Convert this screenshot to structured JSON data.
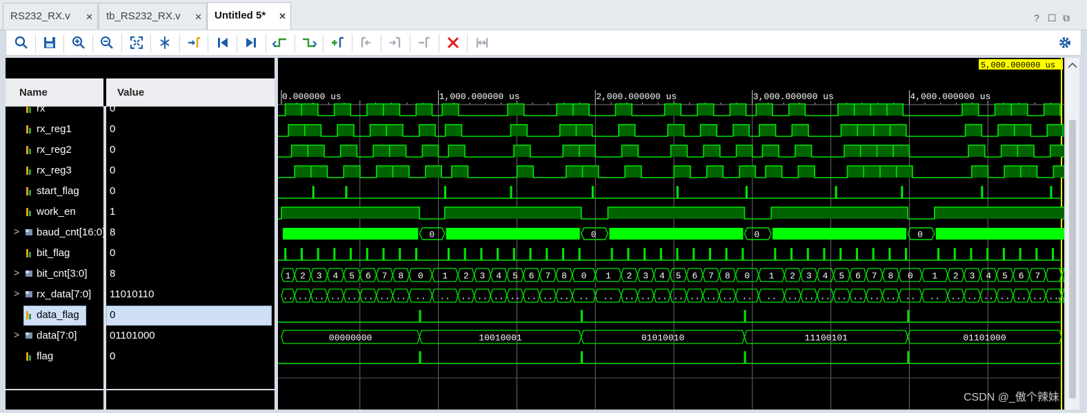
{
  "tabs": [
    {
      "label": "RS232_RX.v",
      "active": false
    },
    {
      "label": "tb_RS232_RX.v",
      "active": false
    },
    {
      "label": "Untitled 5*",
      "active": true
    }
  ],
  "window_controls": [
    "?",
    "☐",
    "⧉"
  ],
  "toolbar_icons": [
    "search-icon",
    "save-icon",
    "zoom-in-icon",
    "zoom-out-icon",
    "zoom-fit-icon",
    "cursor-icon",
    "go-to-time-0-icon",
    "go-to-start-icon",
    "go-to-end-icon",
    "previous-transition-icon",
    "next-transition-icon",
    "add-marker-icon",
    "previous-marker-icon",
    "next-marker-icon",
    "delete-marker-icon",
    "delete-icon",
    "swap-cursors-icon",
    "settings-icon"
  ],
  "headers": {
    "name": "Name",
    "value": "Value"
  },
  "signals": [
    {
      "name": "rx",
      "value": "0",
      "bus": false
    },
    {
      "name": "rx_reg1",
      "value": "0",
      "bus": false
    },
    {
      "name": "rx_reg2",
      "value": "0",
      "bus": false
    },
    {
      "name": "rx_reg3",
      "value": "0",
      "bus": false
    },
    {
      "name": "start_flag",
      "value": "0",
      "bus": false
    },
    {
      "name": "work_en",
      "value": "1",
      "bus": false
    },
    {
      "name": "baud_cnt[16:0]",
      "value": "8",
      "bus": true
    },
    {
      "name": "bit_flag",
      "value": "0",
      "bus": false
    },
    {
      "name": "bit_cnt[3:0]",
      "value": "8",
      "bus": true
    },
    {
      "name": "rx_data[7:0]",
      "value": "11010110",
      "bus": true
    },
    {
      "name": "data_flag",
      "value": "0",
      "bus": false,
      "selected": true
    },
    {
      "name": "data[7:0]",
      "value": "01101000",
      "bus": true
    },
    {
      "name": "flag",
      "value": "0",
      "bus": false
    }
  ],
  "timeline": {
    "cursor_label": "5,000.000000 us",
    "ticks": [
      "0.000000 us",
      "1,000.000000 us",
      "2,000.000000 us",
      "3,000.000000 us",
      "4,000.000000 us",
      "5"
    ]
  },
  "bus_values": {
    "baud_zero_label": "0",
    "bit_cnt": [
      "1",
      "2",
      "3",
      "4",
      "5",
      "6",
      "7",
      "8",
      "0",
      "1",
      "2",
      "3",
      "4",
      "5",
      "6",
      "7",
      "8",
      "0",
      "1",
      "2",
      "3",
      "4",
      "5",
      "6",
      "7",
      "8",
      "0",
      "1",
      "2",
      "3",
      "4",
      "5",
      "6",
      "7",
      "8",
      "0",
      "1",
      "2",
      "3",
      "4",
      "5",
      "6",
      "7"
    ],
    "rx_data_labels": [
      "1001...",
      "0101...",
      "1110...",
      "01101000"
    ],
    "rx_data_short": "..",
    "data": [
      "00000000",
      "10010001",
      "01010010",
      "11100101",
      "01101000"
    ]
  },
  "colors": {
    "wave": "#00e600",
    "bus_fill": "#006400",
    "bright": "#00ff00",
    "cursor": "#ffff00",
    "panel": "#000000"
  },
  "watermark": "CSDN @_傲个辣妹"
}
